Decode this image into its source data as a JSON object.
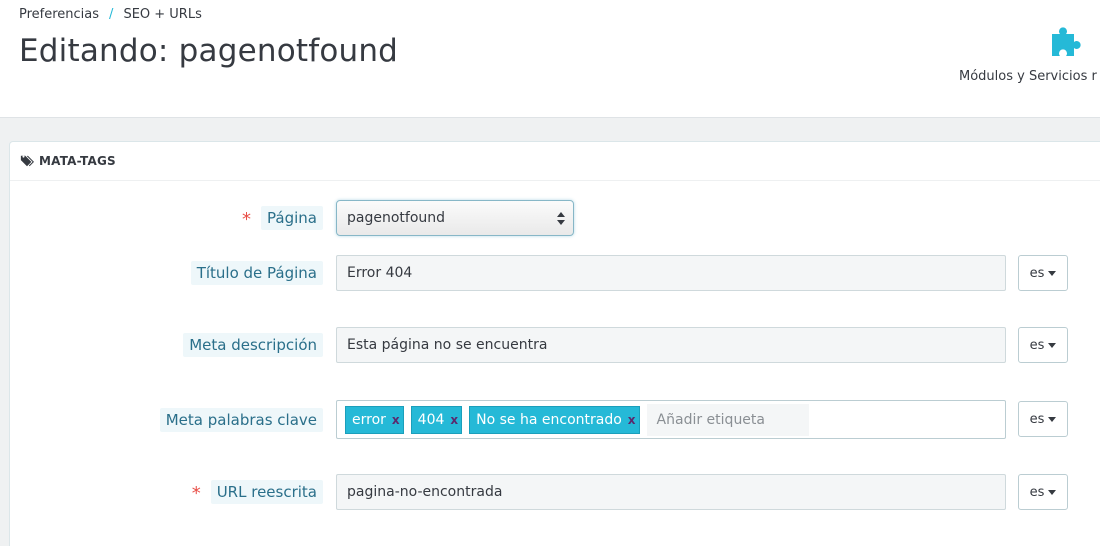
{
  "breadcrumb": {
    "parent": "Preferencias",
    "separator": "/",
    "current": "SEO + URLs"
  },
  "page_title": "Editando: pagenotfound",
  "header_toolbar": {
    "modules_label": "Módulos y Servicios r",
    "modules_icon": "puzzle-icon"
  },
  "panel": {
    "heading": "MATA-TAGS",
    "heading_icon": "tag-icon",
    "fields": {
      "page": {
        "label": "Página",
        "required": "*",
        "value": "pagenotfound"
      },
      "page_title": {
        "label": "Título de Página",
        "value": "Error 404",
        "lang": "es"
      },
      "meta_description": {
        "label": "Meta descripción",
        "value": "Esta página no se encuentra",
        "lang": "es"
      },
      "meta_keywords": {
        "label": "Meta palabras clave",
        "tags": [
          "error",
          "404",
          "No se ha encontrado"
        ],
        "remove_glyph": "x",
        "placeholder": "Añadir etiqueta",
        "lang": "es"
      },
      "rewritten_url": {
        "label": "URL reescrita",
        "required": "*",
        "value": "pagina-no-encontrada",
        "lang": "es"
      }
    }
  },
  "colors": {
    "accent": "#25b9d7",
    "required": "#e84e47",
    "label_text": "#2a6f8a"
  }
}
